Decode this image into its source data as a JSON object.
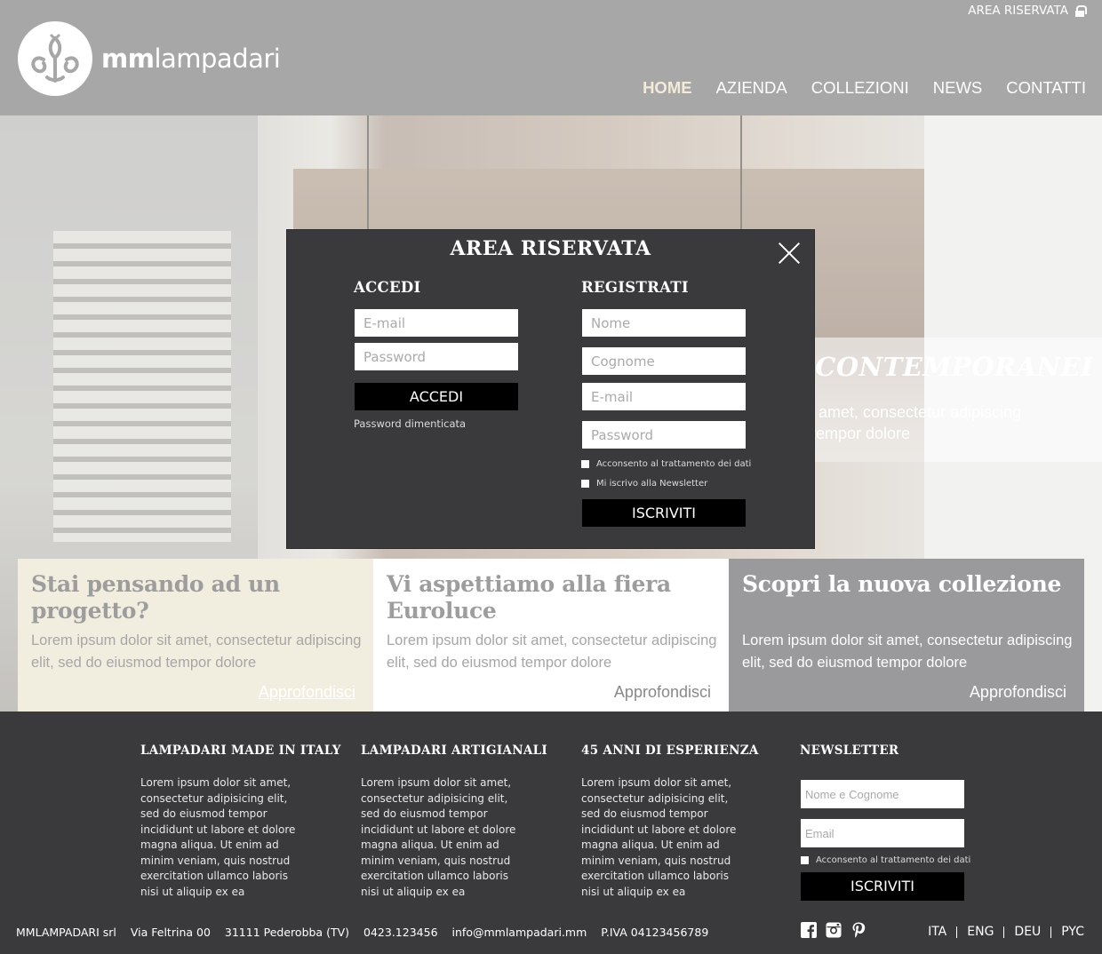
{
  "header": {
    "logo_text_bold": "mm",
    "logo_text_light": "lampadari",
    "reserved_area": "AREA RISERVATA",
    "nav": [
      "HOME",
      "AZIENDA",
      "COLLEZIONI",
      "NEWS",
      "CONTATTI"
    ],
    "active_nav": "HOME",
    "accent_color": "#f2ebd9"
  },
  "hero": {
    "banner_title": "RI CONTEMPORANEI",
    "banner_text_line1": "sit amet, consectetur adipiscing",
    "banner_text_line2": "d tempor dolore"
  },
  "modal": {
    "title": "AREA RISERVATA",
    "login": {
      "title": "ACCEDI",
      "email_placeholder": "E-mail",
      "password_placeholder": "Password",
      "button": "ACCEDI",
      "forgot": "Password dimenticata"
    },
    "register": {
      "title": "REGISTRATI",
      "name_placeholder": "Nome",
      "surname_placeholder": "Cognome",
      "email_placeholder": "E-mail",
      "password_placeholder": "Password",
      "consent": "Acconsento al trattamento dei dati",
      "newsletter": "Mi iscrivo alla Newsletter",
      "button": "ISCRIVITI"
    }
  },
  "cards": [
    {
      "title": "Stai pensando ad un progetto?",
      "text": "Lorem ipsum dolor sit amet, consectetur adipiscing elit, sed do eiusmod tempor dolore",
      "link": "Approfondisci"
    },
    {
      "title": "Vi aspettiamo alla fiera Euroluce",
      "text": "Lorem ipsum dolor sit amet, consectetur adipiscing elit, sed do eiusmod tempor dolore",
      "link": "Approfondisci"
    },
    {
      "title": "Scopri la nuova collezione",
      "text": "Lorem ipsum dolor sit amet, consectetur adipiscing elit, sed do eiusmod tempor dolore",
      "link": "Approfondisci"
    }
  ],
  "footer": {
    "columns": [
      {
        "title": "LAMPADARI MADE IN ITALY",
        "text": "Lorem ipsum dolor sit amet, consectetur adipisicing elit, sed do eiusmod tempor incididunt ut labore et dolore magna aliqua. Ut enim ad minim veniam, quis nostrud exercitation ullamco laboris nisi ut aliquip ex ea"
      },
      {
        "title": "LAMPADARI ARTIGIANALI",
        "text": "Lorem ipsum dolor sit amet, consectetur adipisicing elit, sed do eiusmod tempor incididunt ut labore et dolore magna aliqua. Ut enim ad minim veniam, quis nostrud exercitation ullamco laboris nisi ut aliquip ex ea"
      },
      {
        "title": "45 ANNI DI ESPERIENZA",
        "text": "Lorem ipsum dolor sit amet, consectetur adipisicing elit, sed do eiusmod tempor incididunt ut labore et dolore magna aliqua. Ut enim ad minim veniam, quis nostrud exercitation ullamco laboris nisi ut aliquip ex ea"
      }
    ],
    "newsletter": {
      "title": "NEWSLETTER",
      "name_placeholder": "Nome e Cognome",
      "email_placeholder": "Email",
      "consent": "Acconsento al trattamento dei dati",
      "button": "ISCRIVITI"
    },
    "company": "MMLAMPADARI srl",
    "address": "Via Feltrina 00",
    "city": "31111 Pederobba  (TV)",
    "phone": "0423.123456",
    "email": "info@mmlampadari.mm",
    "vat": "P.IVA 04123456789",
    "social": [
      "facebook-icon",
      "instagram-icon",
      "pinterest-icon"
    ],
    "languages": [
      "ITA",
      "ENG",
      "DEU",
      "PYC"
    ]
  }
}
